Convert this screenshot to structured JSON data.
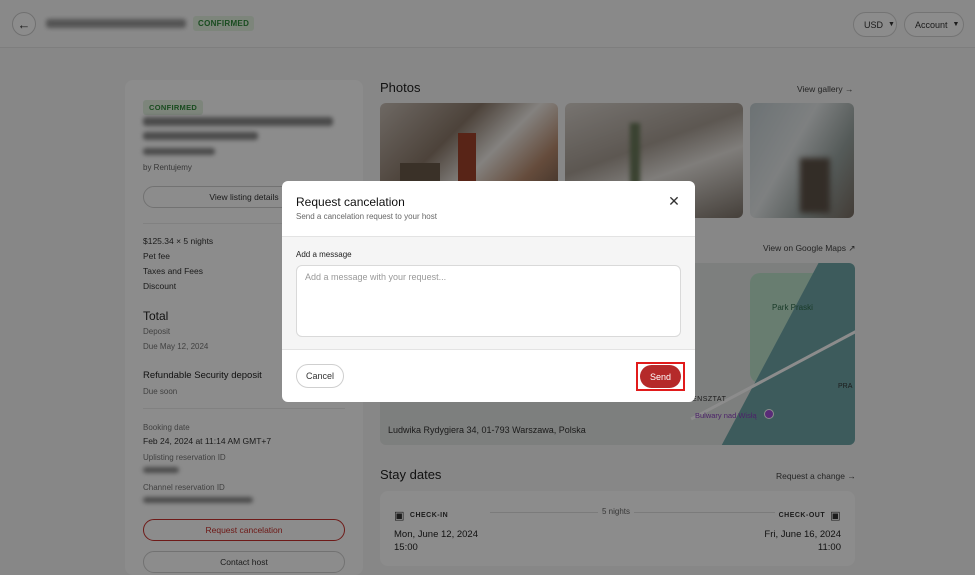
{
  "topbar": {
    "back_icon": "arrow-left-icon",
    "status": "CONFIRMED",
    "currency_label": "USD",
    "account_label": "Account",
    "chevron_icon": "chevron-down-icon"
  },
  "booking": {
    "status": "CONFIRMED",
    "host_line": "by Rentujemy",
    "view_listing_label": "View listing details",
    "price_items": [
      "$125.34 × 5 nights",
      "Pet fee",
      "Taxes and Fees",
      "Discount"
    ],
    "total_label": "Total",
    "deposit_label": "Deposit",
    "due_date": "Due May 12, 2024",
    "security_label": "Refundable Security deposit",
    "security_due": "Due soon",
    "booking_date_label": "Booking date",
    "booking_date_value": "Feb 24, 2024 at 11:14 AM GMT+7",
    "uplisting_label": "Uplisting reservation ID",
    "channel_label": "Channel reservation ID",
    "request_cancel_label": "Request cancelation",
    "contact_host_label": "Contact host"
  },
  "photos": {
    "title": "Photos",
    "view_gallery": "View gallery →"
  },
  "map": {
    "view_on_maps": "View on Google Maps",
    "external_icon": "external-link-icon",
    "address": "Ludwika Rydygiera 34, 01-793 Warszawa, Polska",
    "park_label": "Park Praski",
    "bulwary_label": "Bulwary nad Wisłą",
    "nsztat_label": "ENSZTAT",
    "pra_label": "PRA"
  },
  "stay": {
    "title": "Stay dates",
    "request_change": "Request a change →",
    "checkin_label": "CHECK-IN",
    "checkout_label": "CHECK-OUT",
    "nights": "5 nights",
    "checkin_date": "Mon, June 12, 2024",
    "checkin_time": "15:00",
    "checkout_date": "Fri, June 16, 2024",
    "checkout_time": "11:00"
  },
  "modal": {
    "title": "Request cancelation",
    "subtitle": "Send a cancelation request to your host",
    "close_icon": "close-icon",
    "message_label": "Add a message",
    "message_placeholder": "Add a message with your request...",
    "message_value": "",
    "cancel_label": "Cancel",
    "send_label": "Send"
  },
  "colors": {
    "accent": "#b52a2a",
    "confirmed": "#2f8a3a",
    "highlight": "#e11b1b"
  }
}
